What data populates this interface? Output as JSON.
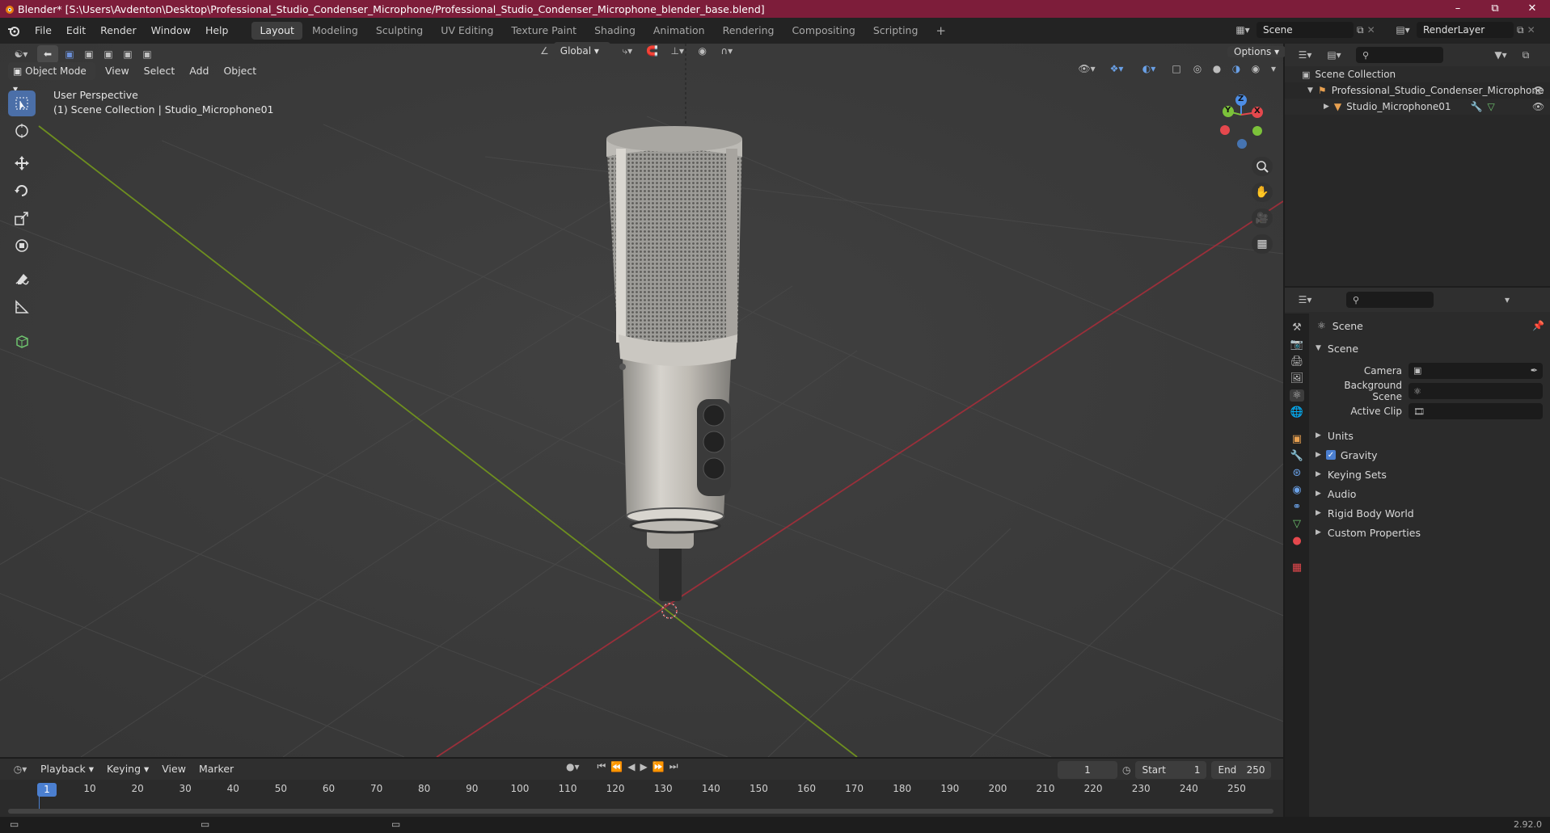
{
  "window": {
    "title": "Blender* [S:\\Users\\Avdenton\\Desktop\\Professional_Studio_Condenser_Microphone/Professional_Studio_Condenser_Microphone_blender_base.blend]"
  },
  "menu": {
    "items": [
      "File",
      "Edit",
      "Render",
      "Window",
      "Help"
    ]
  },
  "workspaces": [
    "Layout",
    "Modeling",
    "Sculpting",
    "UV Editing",
    "Texture Paint",
    "Shading",
    "Animation",
    "Rendering",
    "Compositing",
    "Scripting"
  ],
  "scene_field": "Scene",
  "renderlayer_field": "RenderLayer",
  "viewport": {
    "mode": "Object Mode",
    "menus": [
      "View",
      "Select",
      "Add",
      "Object"
    ],
    "orientation": "Global",
    "options_label": "Options",
    "overlay_title": "User Perspective",
    "overlay_subtitle": "(1) Scene Collection | Studio_Microphone01",
    "gizmo": {
      "x": "X",
      "y": "Y",
      "z": "Z"
    }
  },
  "outliner": {
    "root": "Scene Collection",
    "collection": "Professional_Studio_Condenser_Microphone",
    "object": "Studio_Microphone01"
  },
  "properties": {
    "header": "Scene",
    "panel": "Scene",
    "camera_label": "Camera",
    "background_scene_label": "Background Scene",
    "active_clip_label": "Active Clip",
    "sections": [
      "Units",
      "Gravity",
      "Keying Sets",
      "Audio",
      "Rigid Body World",
      "Custom Properties"
    ]
  },
  "timeline": {
    "menus": [
      "Playback",
      "Keying",
      "View",
      "Marker"
    ],
    "current_frame": "1",
    "start_label": "Start",
    "start_value": "1",
    "end_label": "End",
    "end_value": "250",
    "ruler": [
      "1",
      "10",
      "20",
      "30",
      "40",
      "50",
      "60",
      "70",
      "80",
      "90",
      "100",
      "110",
      "120",
      "130",
      "140",
      "150",
      "160",
      "170",
      "180",
      "190",
      "200",
      "210",
      "220",
      "230",
      "240",
      "250"
    ]
  },
  "status": {
    "version": "2.92.0"
  }
}
